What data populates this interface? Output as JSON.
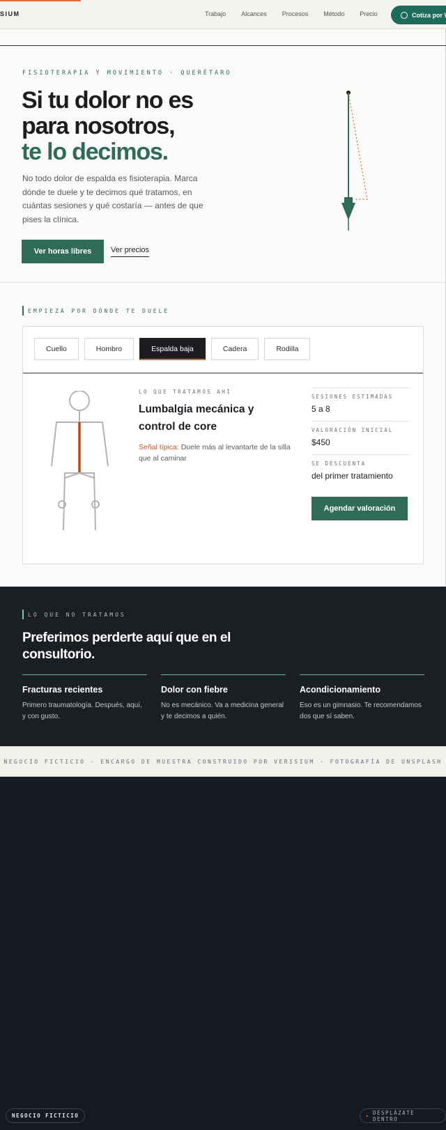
{
  "nav": {
    "brand": "SIUM",
    "links": [
      "Trabajo",
      "Alcances",
      "Procesos",
      "Método",
      "Precio"
    ],
    "cta": "Cotiza por W"
  },
  "hero": {
    "eyebrow": "FISIOTERAPIA Y MOVIMIENTO · QUERÉTARO",
    "title_line1": "Si tu dolor no es",
    "title_line2": "para nosotros,",
    "title_line3": "te lo decimos.",
    "copy": "No todo dolor de espalda es fisioterapia. Marca dónde te duele y te decimos qué tratamos, en cuántas sesiones y qué costaría — antes de que pises la clínica.",
    "primary_button": "Ver horas libres",
    "secondary_link": "Ver precios"
  },
  "selector": {
    "label": "EMPIEZA POR DÓNDE TE DUELE",
    "tabs": [
      "Cuello",
      "Hombro",
      "Espalda baja",
      "Cadera",
      "Rodilla"
    ],
    "active_tab": "Espalda baja",
    "eyebrow": "LO QUE TRATAMOS AHÍ",
    "title": "Lumbalgia mecánica y control de core",
    "sign_label": "Señal típica:",
    "sign_text": " Duele más al levantarte de la silla que al caminar",
    "stats": [
      {
        "key": "SESIONES ESTIMADAS",
        "value": "5 a 8"
      },
      {
        "key": "VALORACIÓN INICIAL",
        "value": "$450"
      },
      {
        "key": "SE DESCUENTA",
        "value": "del primer tratamiento"
      }
    ],
    "button": "Agendar valoración"
  },
  "not_treated": {
    "label": "LO QUE NO TRATAMOS",
    "title": "Preferimos perderte aquí que en el consultorio.",
    "items": [
      {
        "heading": "Fracturas recientes",
        "text": "Primero traumatología. Después, aquí, y con gusto."
      },
      {
        "heading": "Dolor con fiebre",
        "text": "No es mecánico. Va a medicina general y te decimos a quién."
      },
      {
        "heading": "Acondicionamiento",
        "text": "Eso es un gimnasio. Te recomendamos dos que sí saben."
      }
    ]
  },
  "strip": {
    "text": "NEGOCIO FICTICIO · ENCARGO DE MUESTRA CONSTRUIDO POR VERISIUM · FOTOGRAFÍA DE UNSPLASH"
  },
  "chips": {
    "left": "NEGOCIO FICTICIO",
    "right": "DESPLÁZATE DENTRO"
  },
  "colors": {
    "brand_green": "#2f6b58",
    "accent_orange": "#d86a2b",
    "dark_bg": "#1b1e22",
    "page_bg": "#151a22"
  }
}
